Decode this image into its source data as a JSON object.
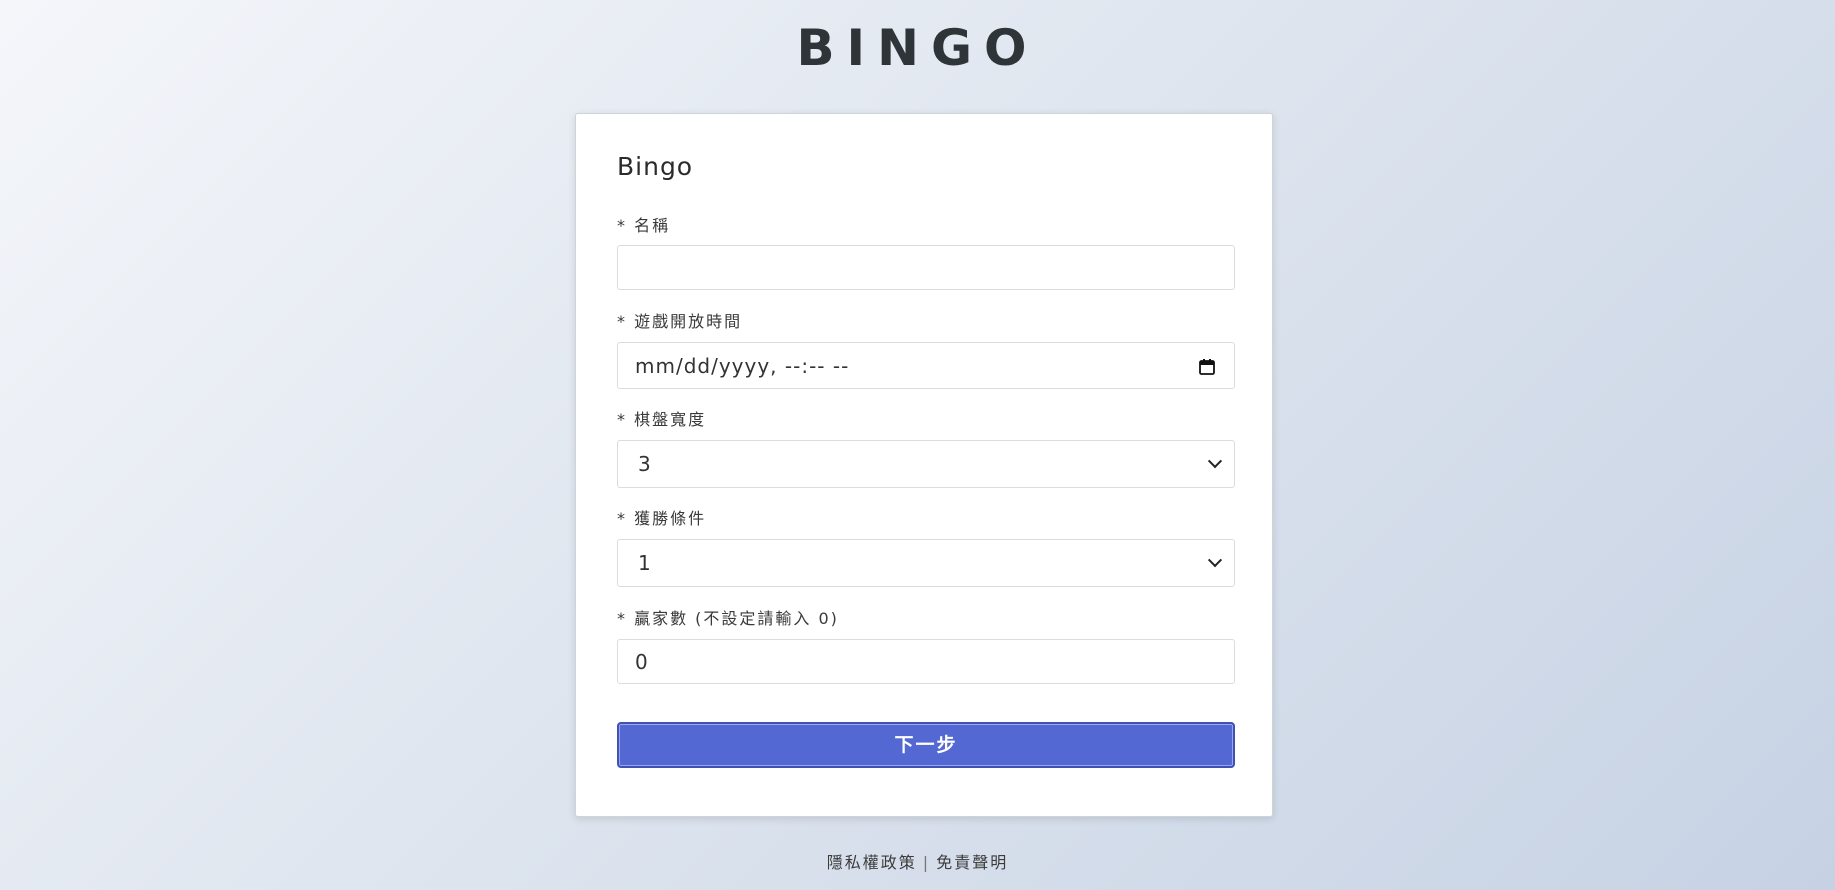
{
  "header": {
    "title": "BINGO"
  },
  "form": {
    "title": "Bingo",
    "name_field": {
      "label": "* 名稱",
      "value": ""
    },
    "open_time_field": {
      "label": "* 遊戲開放時間",
      "value": "mm/dd/yyyy, --:-- --",
      "icon": "calendar-icon"
    },
    "board_width_field": {
      "label": "* 棋盤寬度",
      "selected": "3",
      "icon": "chevron-down-icon"
    },
    "win_condition_field": {
      "label": "* 獲勝條件",
      "selected": "1",
      "icon": "chevron-down-icon"
    },
    "winner_count_field": {
      "label": "* 贏家數 (不設定請輸入 0)",
      "value": "0"
    },
    "submit_label": "下一步"
  },
  "footer": {
    "privacy_label": "隱私權政策",
    "separator": "|",
    "disclaimer_label": "免責聲明"
  },
  "colors": {
    "primary_button": "#5468d4",
    "title_text": "#2e3438"
  }
}
